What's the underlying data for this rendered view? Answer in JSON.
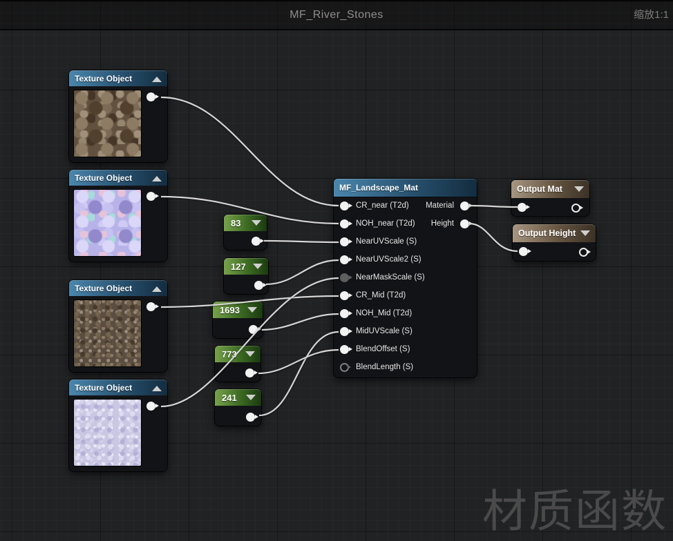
{
  "titlebar": {
    "title": "MF_River_Stones",
    "zoom_label": "缩放1:1"
  },
  "watermark": "材质函数",
  "texture_nodes": [
    {
      "title": "Texture Object",
      "preview": "brown-pebbles-diffuse"
    },
    {
      "title": "Texture Object",
      "preview": "coarse-normal-map"
    },
    {
      "title": "Texture Object",
      "preview": "fine-brown-gravel-diffuse"
    },
    {
      "title": "Texture Object",
      "preview": "fine-normal-map"
    }
  ],
  "constant_nodes": [
    {
      "value": "83"
    },
    {
      "value": "127"
    },
    {
      "value": "1693"
    },
    {
      "value": "773"
    },
    {
      "value": "241"
    }
  ],
  "function_node": {
    "title": "MF_Landscape_Mat",
    "inputs": [
      {
        "label": "CR_near (T2d)",
        "state": "connected"
      },
      {
        "label": "NOH_near (T2d)",
        "state": "connected"
      },
      {
        "label": "NearUVScale (S)",
        "state": "connected"
      },
      {
        "label": "NearUVScale2 (S)",
        "state": "connected"
      },
      {
        "label": "NearMaskScale (S)",
        "state": "muted"
      },
      {
        "label": "CR_Mid (T2d)",
        "state": "connected"
      },
      {
        "label": "NOH_Mid (T2d)",
        "state": "connected"
      },
      {
        "label": "MidUVScale (S)",
        "state": "connected"
      },
      {
        "label": "BlendOffset (S)",
        "state": "connected"
      },
      {
        "label": "BlendLength (S)",
        "state": "unconnected"
      }
    ],
    "outputs": [
      {
        "label": "Material"
      },
      {
        "label": "Height"
      }
    ]
  },
  "output_nodes": [
    {
      "title": "Output Mat"
    },
    {
      "title": "Output Height"
    }
  ],
  "colors": {
    "texture_header": "#4a86ad",
    "constant_header": "#77a24b",
    "output_header": "#a79681",
    "wire": "#d6d6d6",
    "background": "#212224"
  }
}
